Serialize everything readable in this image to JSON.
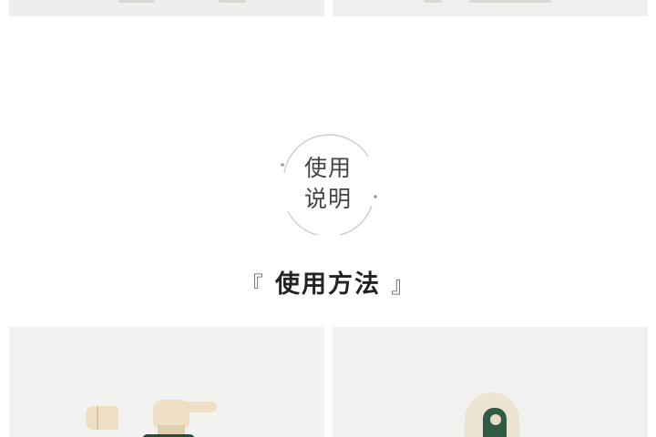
{
  "badge": {
    "line1": "使用",
    "line2": "说明"
  },
  "heading": {
    "open_bracket": "『",
    "title": "使用方法",
    "close_bracket": "』"
  },
  "colors": {
    "text_dark": "#222222",
    "circle_stroke": "#c9c9c9",
    "bottle_green": "#264d3a",
    "cap_cream": "#efdfc6"
  },
  "images": [
    {
      "name": "product-photo-top-left"
    },
    {
      "name": "product-photo-top-right"
    },
    {
      "name": "pump-bottle-photo"
    },
    {
      "name": "tube-cap-photo"
    }
  ]
}
